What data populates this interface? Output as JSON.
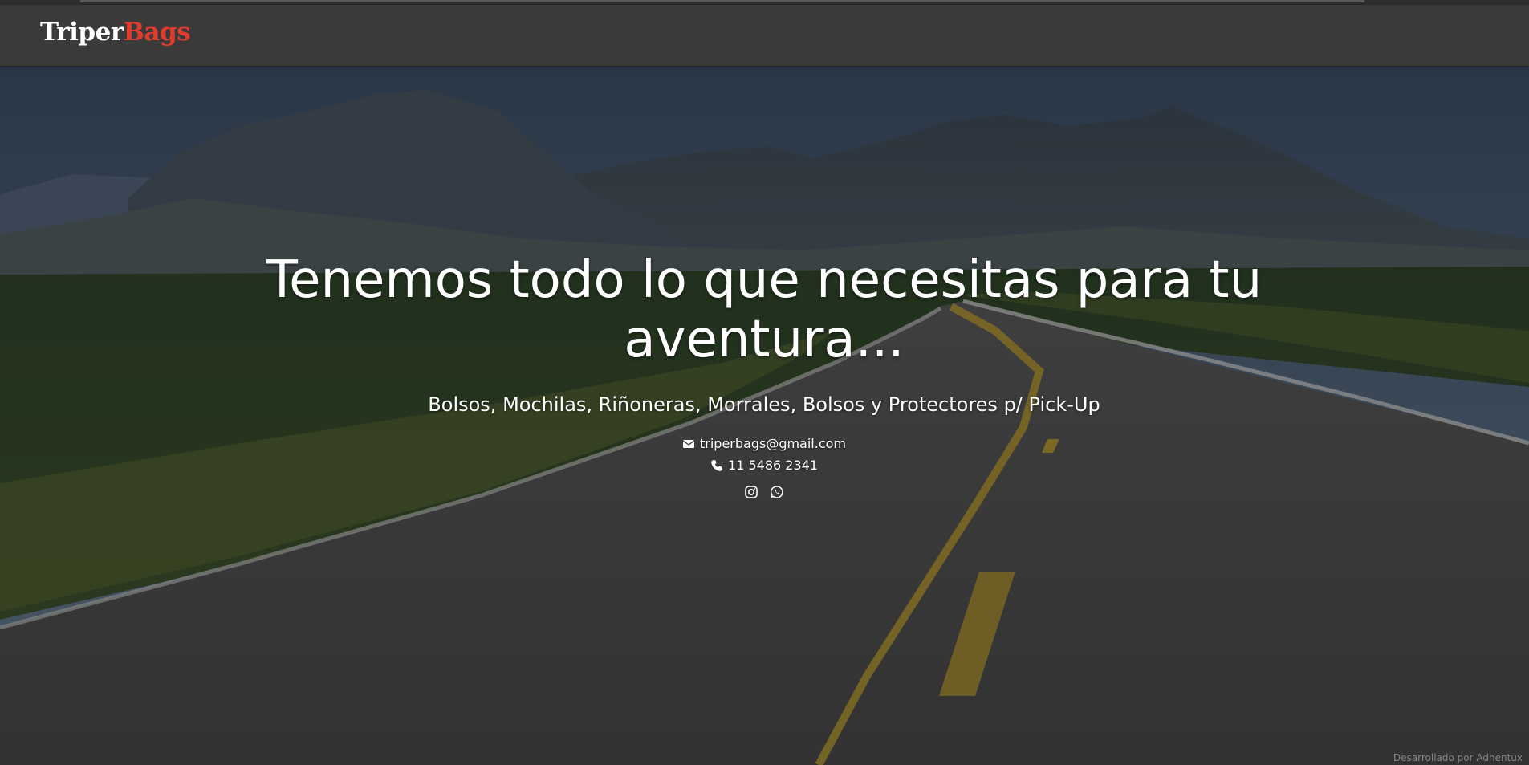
{
  "brand": {
    "part1": "Triper",
    "part2": "Bags",
    "colors": {
      "part1": "#ffffff",
      "part2": "#e23b2e"
    }
  },
  "hero": {
    "headline": "Tenemos todo lo que necesitas para tu aventura...",
    "subheadline": "Bolsos, Mochilas, Riñoneras, Morrales, Bolsos y Protectores p/ Pick-Up",
    "email": {
      "icon": "envelope-icon",
      "text": "triperbags@gmail.com"
    },
    "phone": {
      "icon": "phone-icon",
      "text": "11 5486 2341"
    },
    "social": [
      {
        "icon": "instagram-icon"
      },
      {
        "icon": "whatsapp-icon"
      }
    ],
    "background": "mountain desert road"
  },
  "footer": {
    "credit": "Desarrollado por Adhentux"
  }
}
